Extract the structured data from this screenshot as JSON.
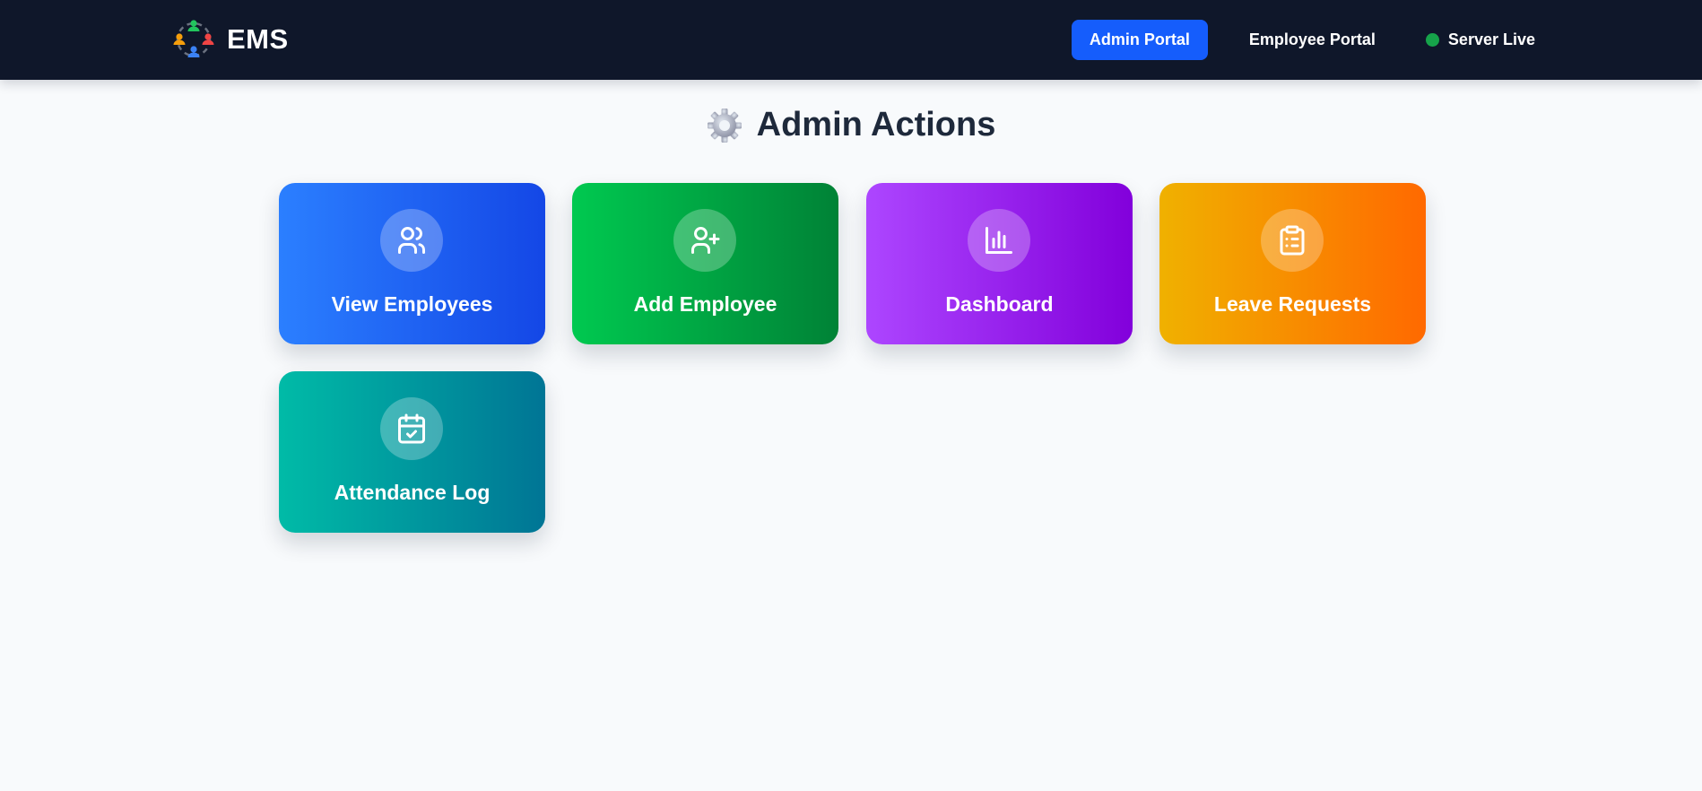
{
  "navbar": {
    "logo_icon": "team-circle-logo-icon",
    "brand": "EMS",
    "admin_portal": "Admin Portal",
    "employee_portal": "Employee Portal",
    "server_status": "Server Live",
    "active_tab": "Admin Portal",
    "colors": {
      "background": "#0f172a",
      "active_button": "#155dfc",
      "status_dot": "#16a34a"
    }
  },
  "main": {
    "title_icon": "gear-icon",
    "title": "Admin Actions",
    "cards": [
      {
        "label": "View Employees",
        "icon": "users-icon",
        "gradient": [
          "#2b7fff",
          "#1447e6"
        ]
      },
      {
        "label": "Add Employee",
        "icon": "user-plus-icon",
        "gradient": [
          "#00c950",
          "#008236"
        ]
      },
      {
        "label": "Dashboard",
        "icon": "bar-chart-icon",
        "gradient": [
          "#ad46ff",
          "#8200db"
        ]
      },
      {
        "label": "Leave Requests",
        "icon": "clipboard-list-icon",
        "gradient": [
          "#f0b100",
          "#ff6900"
        ]
      },
      {
        "label": "Attendance Log",
        "icon": "calendar-check-icon",
        "gradient": [
          "#00bba7",
          "#007595"
        ]
      }
    ]
  }
}
